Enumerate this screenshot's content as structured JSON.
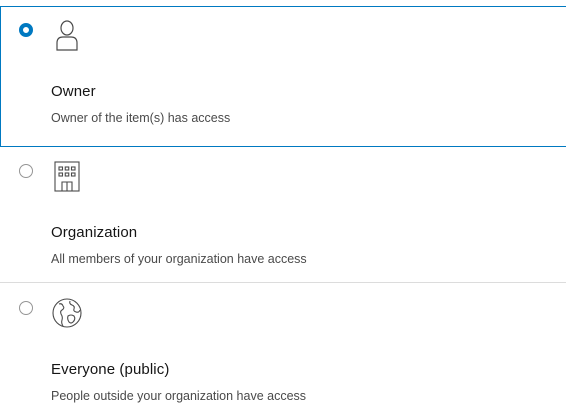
{
  "options": [
    {
      "id": "owner",
      "selected": true,
      "icon": "user-icon",
      "title": "Owner",
      "description": "Owner of the item(s) has access"
    },
    {
      "id": "organization",
      "selected": false,
      "icon": "building-icon",
      "title": "Organization",
      "description": "All members of your organization have access"
    },
    {
      "id": "everyone",
      "selected": false,
      "icon": "globe-icon",
      "title": "Everyone (public)",
      "description": "People outside your organization have access"
    }
  ],
  "colors": {
    "accent": "#0079c1",
    "border": "#dcdcdc",
    "text": "#151515",
    "subtext": "#4a4a4a"
  }
}
